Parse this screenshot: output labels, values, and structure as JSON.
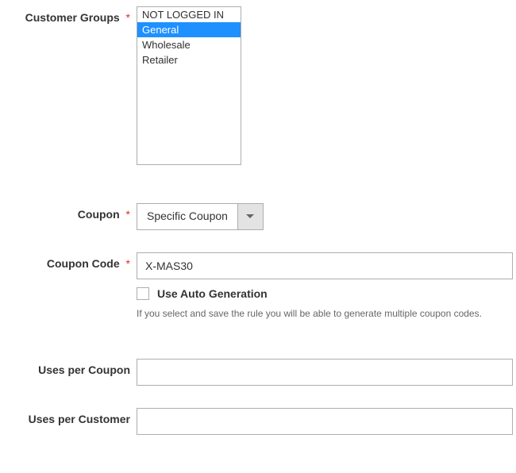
{
  "fields": {
    "customer_groups": {
      "label": "Customer Groups",
      "required_marker": "*",
      "options": [
        "NOT LOGGED IN",
        "General",
        "Wholesale",
        "Retailer"
      ],
      "selected_index": 1
    },
    "coupon": {
      "label": "Coupon",
      "required_marker": "*",
      "value": "Specific Coupon"
    },
    "coupon_code": {
      "label": "Coupon Code",
      "required_marker": "*",
      "value": "X-MAS30"
    },
    "auto_generation": {
      "checkbox_label": "Use Auto Generation",
      "help": "If you select and save the rule you will be able to generate multiple coupon codes."
    },
    "uses_per_coupon": {
      "label": "Uses per Coupon",
      "value": ""
    },
    "uses_per_customer": {
      "label": "Uses per Customer",
      "value": ""
    }
  }
}
